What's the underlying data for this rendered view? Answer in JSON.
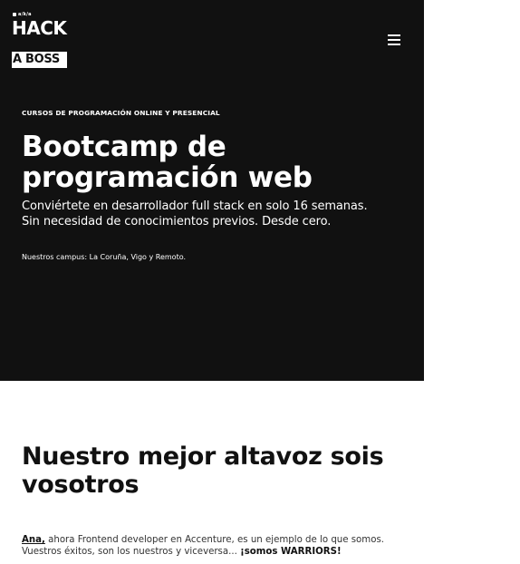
{
  "logo": {
    "top_text": "HACK",
    "bottom_text": "A BOSS",
    "badge_text": "a/k/a"
  },
  "hero": {
    "eyebrow": "CURSOS DE PROGRAMACIÓN ONLINE Y PRESENCIAL",
    "title_line1": "Bootcamp de",
    "title_line2": "programación web",
    "subtitle_line1": "Conviértete en desarrollador full stack en solo 16 semanas.",
    "subtitle_line2": "Sin necesidad de conocimientos previos. Desde cero.",
    "campus": "Nuestros campus: La Coruña, Vigo y Remoto."
  },
  "section": {
    "title_line1": "Nuestro mejor altavoz sois",
    "title_line2": "vosotros"
  },
  "testimonial": {
    "name": "Ana,",
    "text1": " ahora Frontend developer en Accenture, es un ejemplo de lo que somos.",
    "text2": "Vuestros éxitos, son los nuestros y viceversa... ",
    "highlight": "¡somos WARRIORS!"
  },
  "colors": {
    "hero_bg": "#111111",
    "text_light": "#ffffff",
    "text_dark": "#111111"
  },
  "icons": {
    "menu": "hamburger-menu-icon"
  }
}
